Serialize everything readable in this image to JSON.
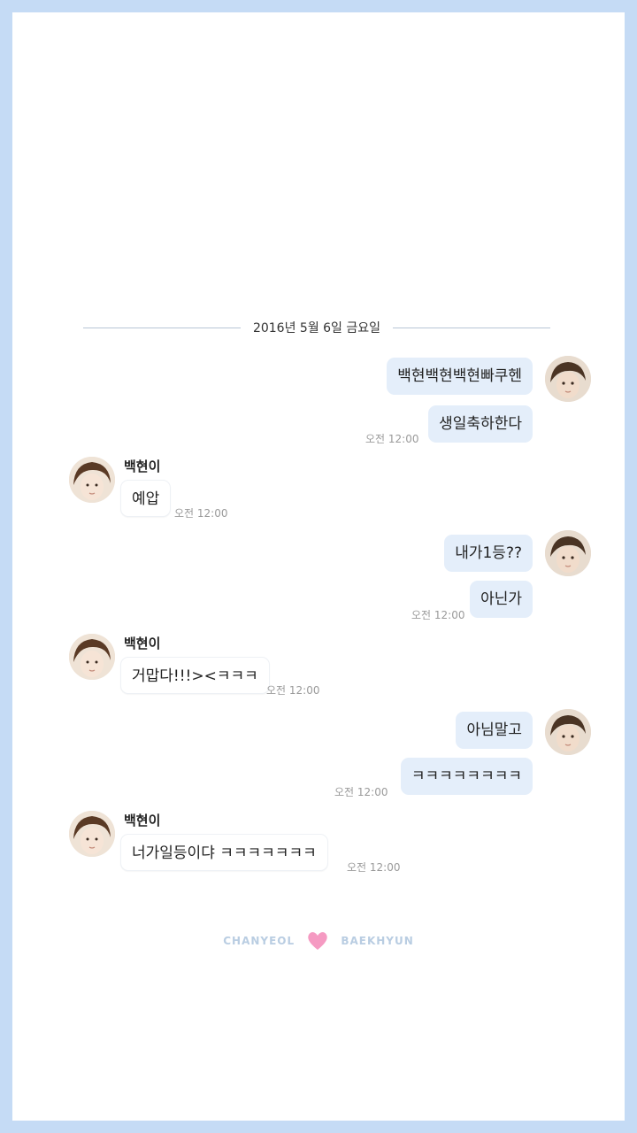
{
  "date_separator": "2016년 5월 6일 금요일",
  "messages": [
    {
      "text": "백현백현백현빠쿠헨"
    },
    {
      "text": "생일축하한다",
      "time": "오전 12:00"
    },
    {
      "sender": "백현이",
      "text": "예압",
      "time": "오전 12:00"
    },
    {
      "text": "내가1등??"
    },
    {
      "text": "아닌가",
      "time": "오전 12:00"
    },
    {
      "sender": "백현이",
      "text": "거맙다!!!><ㅋㅋㅋ",
      "time": "오전 12:00"
    },
    {
      "text": "아님말고"
    },
    {
      "text": "ㅋㅋㅋㅋㅋㅋㅋㅋ",
      "time": "오전 12:00"
    },
    {
      "sender": "백현이",
      "text": "너가일등이댜 ㅋㅋㅋㅋㅋㅋㅋ",
      "time": "오전 12:00"
    }
  ],
  "footer": {
    "left": "CHANYEOL",
    "right": "BAEKHYUN",
    "heart_color": "#f59ac2"
  },
  "colors": {
    "border": "#c5dbf5",
    "my_bubble": "#e4eefa"
  }
}
